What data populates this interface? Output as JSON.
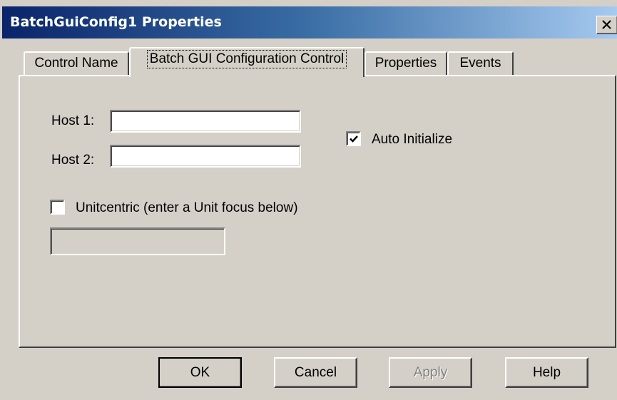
{
  "window": {
    "title": "BatchGuiConfig1 Properties"
  },
  "tabs": [
    {
      "label": "Control Name",
      "active": false
    },
    {
      "label": "Batch GUI Configuration Control",
      "active": true
    },
    {
      "label": "Properties",
      "active": false
    },
    {
      "label": "Events",
      "active": false
    }
  ],
  "form": {
    "host1_label": "Host 1:",
    "host1_value": "",
    "host2_label": "Host 2:",
    "host2_value": "",
    "auto_initialize_label": "Auto Initialize",
    "auto_initialize_checked": true,
    "unitcentric_label": "Unitcentric (enter a Unit focus below)",
    "unitcentric_checked": false,
    "unit_focus_value": ""
  },
  "buttons": {
    "ok": "OK",
    "cancel": "Cancel",
    "apply": "Apply",
    "help": "Help"
  },
  "icons": {
    "close": "close-icon",
    "check": "check-icon"
  },
  "colors": {
    "titlebar_start": "#0a246a",
    "titlebar_end": "#a6caf0",
    "face": "#d4d0c8"
  }
}
